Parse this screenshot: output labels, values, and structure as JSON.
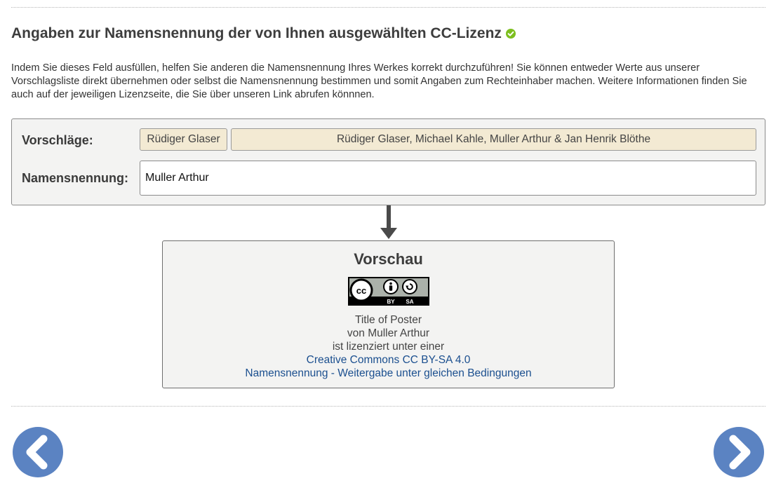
{
  "heading": {
    "title": "Angaben zur Namensnennung der von Ihnen ausgewählten CC-Lizenz",
    "status_icon": "check-circle-icon",
    "status_color": "#7dbf1f"
  },
  "intro": "Indem Sie dieses Feld ausfüllen, helfen Sie anderen die Namensnennung Ihres Werkes korrekt durchzuführen! Sie können entweder Werte aus unserer Vorschlagsliste direkt übernehmen oder selbst die Namensnennung bestimmen und somit Angaben zum Rechteinhaber machen. Weitere Informationen finden Sie auch auf der jeweiligen Lizenzseite, die Sie über unseren Link abrufen könnnen.",
  "form": {
    "suggestions_label": "Vorschläge:",
    "suggestions": [
      "Rüdiger Glaser",
      "Rüdiger Glaser, Michael Kahle, Muller Arthur & Jan Henrik Blöthe"
    ],
    "attribution_label": "Namensnennung:",
    "attribution_value": "Muller Arthur"
  },
  "preview": {
    "title": "Vorschau",
    "badge": {
      "icon": "cc-by-sa-icon",
      "left_text": "BY",
      "right_text": "SA"
    },
    "work_title": "Title of Poster",
    "author_line": "von Muller Arthur",
    "licensed_line": "ist lizenziert unter einer",
    "license_link": "Creative Commons CC BY-SA 4.0",
    "license_name_link": "Namensnennung - Weitergabe unter gleichen Bedingungen",
    "link_color": "#1b4f8f"
  },
  "navigation": {
    "prev_icon": "chevron-left-icon",
    "next_icon": "chevron-right-icon",
    "button_color": "#5b83c2"
  }
}
